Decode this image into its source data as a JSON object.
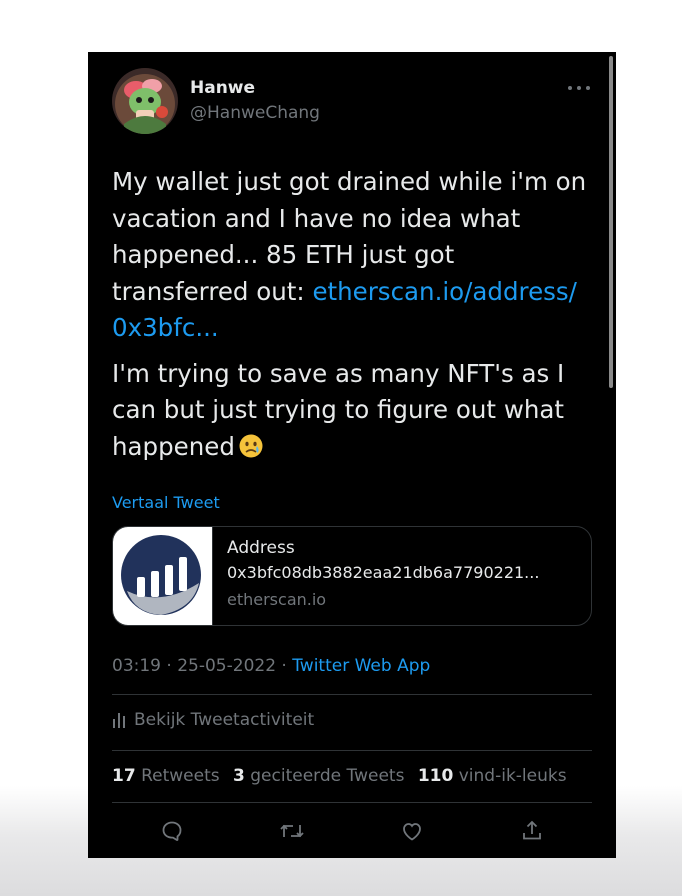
{
  "author": {
    "display_name": "Hanwe",
    "handle": "@HanweChang"
  },
  "tweet": {
    "text1_pre": "My wallet just got drained while i'm on vacation and I have no idea what happened... 85 ETH just got transferred out: ",
    "link_text": "etherscan.io/address/ 0x3bfc...",
    "text2": "I'm trying to save as many NFT's as I can but just trying to figure out what happened",
    "emoji": "crying-face-emoji"
  },
  "translate_label": "Vertaal Tweet",
  "link_card": {
    "title": "Address",
    "description": "0x3bfc08db3882eaa21db6a7790221...",
    "domain": "etherscan.io"
  },
  "meta": {
    "time": "03:19",
    "sep1": " · ",
    "date": "25-05-2022",
    "sep2": " · ",
    "source": "Twitter Web App"
  },
  "activity_label": "Bekijk Tweetactiviteit",
  "stats": {
    "retweets_count": "17",
    "retweets_label": "Retweets",
    "quotes_count": "3",
    "quotes_label": "geciteerde Tweets",
    "likes_count": "110",
    "likes_label": "vind-ik-leuks"
  },
  "colors": {
    "background": "#000000",
    "text": "#e7e9ea",
    "muted": "#71767b",
    "accent": "#1d9bf0",
    "border": "#2f3336"
  },
  "icons": [
    "more-icon",
    "analytics-icon",
    "reply-icon",
    "retweet-icon",
    "like-icon",
    "share-icon"
  ]
}
